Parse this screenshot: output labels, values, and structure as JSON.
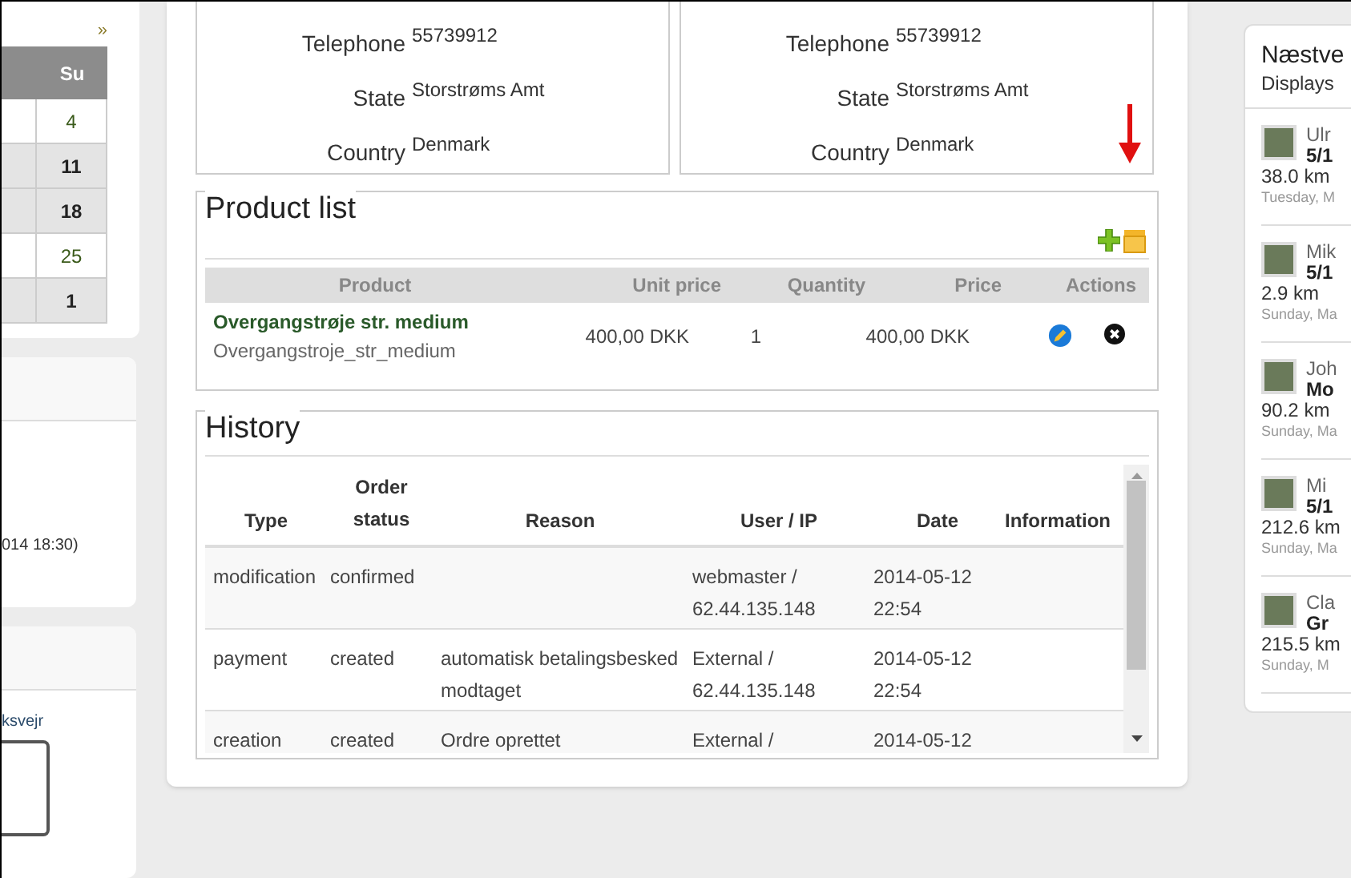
{
  "calendar": {
    "next": "»",
    "header": "Su",
    "days": [
      {
        "day": "4",
        "highlighted": false
      },
      {
        "day": "11",
        "highlighted": true
      },
      {
        "day": "18",
        "highlighted": true
      },
      {
        "day": "25",
        "highlighted": false
      },
      {
        "day": "1",
        "highlighted": true
      }
    ]
  },
  "left_panels": [
    {
      "text": "014 18:30)"
    },
    {
      "text": "ksvejr"
    }
  ],
  "addresses": [
    {
      "fields": [
        {
          "label": "Telephone",
          "value": "55739912"
        },
        {
          "label": "State",
          "value": "Storstrøms Amt"
        },
        {
          "label": "Country",
          "value": "Denmark"
        }
      ]
    },
    {
      "fields": [
        {
          "label": "Telephone",
          "value": "55739912"
        },
        {
          "label": "State",
          "value": "Storstrøms Amt"
        },
        {
          "label": "Country",
          "value": "Denmark"
        }
      ]
    }
  ],
  "product_list": {
    "title": "Product list",
    "columns": [
      "Product",
      "Unit price",
      "Quantity",
      "Price",
      "Actions"
    ],
    "rows": [
      {
        "name": "Overgangstrøje str. medium",
        "sku": "Overgangstroje_str_medium",
        "unit_price": "400,00 DKK",
        "quantity": "1",
        "price": "400,00 DKK"
      }
    ]
  },
  "history": {
    "title": "History",
    "columns": [
      "Type",
      "Order status",
      "Reason",
      "User / IP",
      "Date",
      "Information"
    ],
    "rows": [
      {
        "type": "modification",
        "status": "confirmed",
        "reason": "",
        "user": [
          "webmaster /",
          "62.44.135.148"
        ],
        "date": [
          "2014-05-12",
          "22:54"
        ]
      },
      {
        "type": "payment",
        "status": "created",
        "reason": "automatisk betalingsbesked modtaget",
        "user": [
          "External /",
          "62.44.135.148"
        ],
        "date": [
          "2014-05-12",
          "22:54"
        ]
      },
      {
        "type": "creation",
        "status": "created",
        "reason": "Ordre oprettet",
        "user": [
          "External /"
        ],
        "date": [
          "2014-05-12"
        ]
      }
    ]
  },
  "activity": {
    "title": "Næstve",
    "subtitle": "Displays",
    "entries": [
      {
        "name": "Ulr",
        "title": "5/1",
        "distance": "38.0 km",
        "date": "Tuesday, M"
      },
      {
        "name": "Mik",
        "title": "5/1",
        "distance": "2.9 km",
        "date": "Sunday, Ma"
      },
      {
        "name": "Joh",
        "title": "Mo",
        "distance": "90.2 km",
        "date": "Sunday, Ma"
      },
      {
        "name": "Mi",
        "title": "5/1",
        "distance": "212.6 km",
        "date": "Sunday, Ma"
      },
      {
        "name": "Cla",
        "title": "Gr",
        "distance": "215.5 km",
        "date": "Sunday, M"
      }
    ]
  }
}
